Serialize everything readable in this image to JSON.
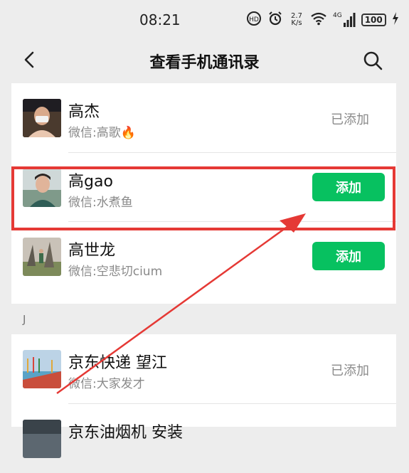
{
  "status_bar": {
    "time": "08:21",
    "net_speed_value": "2.7",
    "net_speed_unit": "K/s",
    "signal_label": "4G",
    "battery": "100",
    "icons": [
      "hd-voice-icon",
      "alarm-icon",
      "wifi-icon",
      "signal-icon",
      "battery-icon",
      "charging-icon"
    ]
  },
  "nav": {
    "title": "查看手机通讯录",
    "back_icon": "chevron-left-icon",
    "search_icon": "search-icon"
  },
  "groups": [
    {
      "contacts": [
        {
          "name": "高杰",
          "wechat": "微信:高歌🔥",
          "action": "已添加",
          "added": true
        },
        {
          "name": "高gao",
          "wechat": "微信:水煮鱼",
          "action": "添加",
          "added": false,
          "highlighted": true
        },
        {
          "name": "高世龙",
          "wechat": "微信:空悲切cium",
          "action": "添加",
          "added": false
        }
      ]
    },
    {
      "section": "J",
      "contacts": [
        {
          "name": "京东快递 望江",
          "wechat": "微信:大家发才",
          "action": "已添加",
          "added": true
        },
        {
          "name": "京东油烟机 安装",
          "wechat": "",
          "action": "",
          "added": false
        }
      ]
    }
  ],
  "annotation": {
    "box_color": "#e53935",
    "arrow_color": "#e53935"
  },
  "colors": {
    "accent": "#07c160",
    "background": "#ededed"
  }
}
